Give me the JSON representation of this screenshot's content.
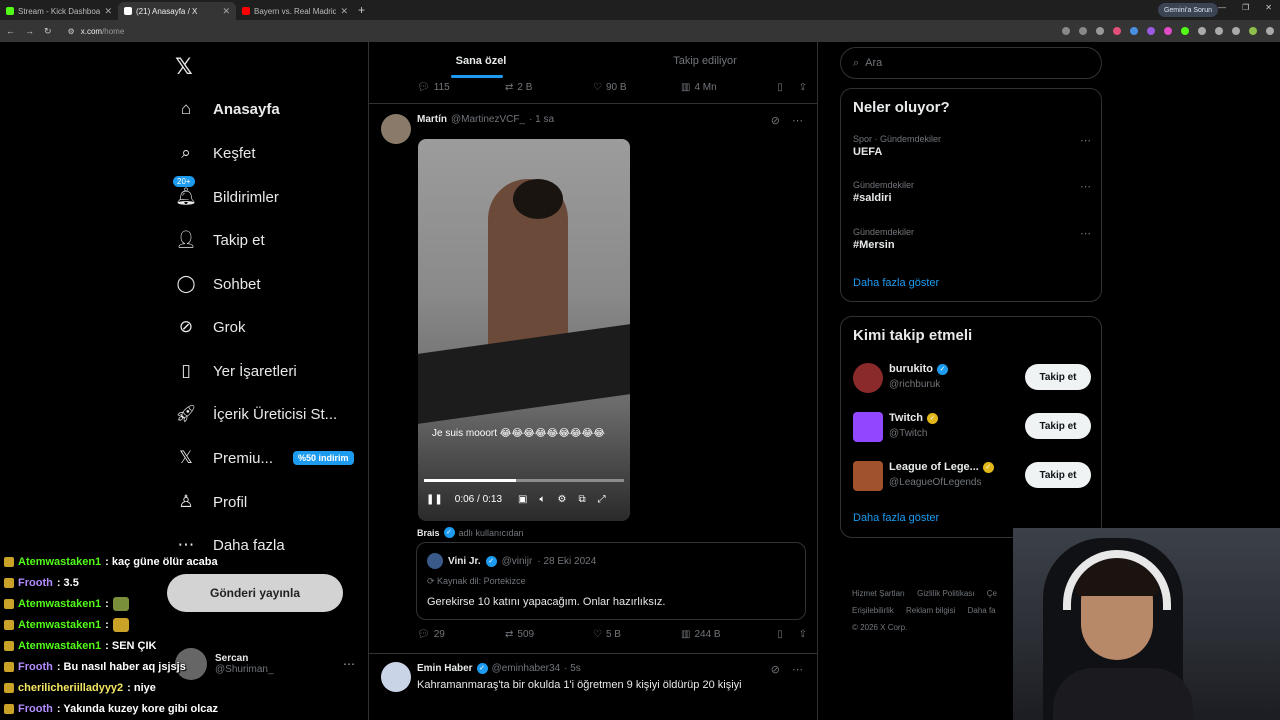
{
  "browser": {
    "tabs": [
      {
        "title": "Stream - Kick Dashboard",
        "color": "#53fc18"
      },
      {
        "title": "(21) Anasayfa / X",
        "color": "#ffffff"
      },
      {
        "title": "Bayern vs. Real Madrid: Extende",
        "color": "#ff0000"
      }
    ],
    "gemini": "Gemini'a Sorun",
    "url_host": "x.com",
    "url_path": "/home"
  },
  "nav": {
    "items": [
      {
        "label": "Anasayfa",
        "icon": "home-icon"
      },
      {
        "label": "Keşfet",
        "icon": "search-icon"
      },
      {
        "label": "Bildirimler",
        "icon": "bell-icon",
        "badge": "20+"
      },
      {
        "label": "Takip et",
        "icon": "person-add-icon"
      },
      {
        "label": "Sohbet",
        "icon": "chat-icon"
      },
      {
        "label": "Grok",
        "icon": "grok-icon"
      },
      {
        "label": "Yer İşaretleri",
        "icon": "bookmark-icon"
      },
      {
        "label": "İçerik Üreticisi St...",
        "icon": "rocket-icon"
      },
      {
        "label": "Premiu...",
        "icon": "x-logo-icon",
        "promo": "%50 indirim"
      },
      {
        "label": "Profil",
        "icon": "person-icon"
      },
      {
        "label": "Daha fazla",
        "icon": "more-circle-icon"
      }
    ],
    "post_button": "Gönderi yayınla",
    "account": {
      "name": "Sercan",
      "handle": "@Shuriman_"
    }
  },
  "chat": [
    {
      "user": "Atemwastaken1",
      "text": ": kaç güne ölür acaba",
      "color": "#53fc18"
    },
    {
      "user": "Frooth",
      "text": ": 3.5",
      "color": "#b38cff"
    },
    {
      "user": "Atemwastaken1",
      "text": ":",
      "color": "#53fc18",
      "emote": true
    },
    {
      "user": "Atemwastaken1",
      "text": ":",
      "color": "#53fc18",
      "emote": true
    },
    {
      "user": "Atemwastaken1",
      "text": ": SEN ÇIK",
      "color": "#53fc18"
    },
    {
      "user": "Frooth",
      "text": ": Bu nasıl haber aq jsjsjs",
      "color": "#b38cff"
    },
    {
      "user": "cherilicheriilladyyy2",
      "text": ": niye",
      "color": "#f5e663"
    },
    {
      "user": "Frooth",
      "text": ": Yakında kuzey kore gibi olcaz",
      "color": "#b38cff"
    }
  ],
  "timeline": {
    "tabs": [
      "Sana özel",
      "Takip ediliyor"
    ],
    "prev_actions": {
      "replies": "115",
      "reposts": "2 B",
      "likes": "90 B",
      "views": "4 Mn"
    },
    "post1": {
      "name": "Martín",
      "handle": "@MartinezVCF_",
      "time": "· 1 sa",
      "video_caption": "Je suis mooort 😂😂😂😂😂😂😂😂😂",
      "video_time": "0:06 / 0:13",
      "video_progress": 0.46,
      "quote_by_name": "Brais",
      "quote_by_text": "adlı kullanıcıdan",
      "quote": {
        "name": "Vini Jr.",
        "handle": "@vinijr",
        "date": "· 28 Eki 2024",
        "source": "Kaynak dil: Portekizce",
        "text": "Gerekirse 10 katını yapacağım. Onlar hazırlıksız."
      },
      "actions": {
        "replies": "29",
        "reposts": "509",
        "likes": "5 B",
        "views": "244 B"
      }
    },
    "post2": {
      "name": "Emin Haber",
      "handle": "@eminhaber34",
      "time": "· 5s",
      "text": "Kahramanmaraş'ta bir okulda 1'i öğretmen 9 kişiyi öldürüp 20 kişiyi"
    }
  },
  "sidebar": {
    "search_placeholder": "Ara",
    "trends_title": "Neler oluyor?",
    "trends": [
      {
        "context": "Spor · Gündemdekiler",
        "title": "UEFA"
      },
      {
        "context": "Gündemdekiler",
        "title": "#saldiri"
      },
      {
        "context": "Gündemdekiler",
        "title": "#Mersin"
      }
    ],
    "show_more": "Daha fazla göster",
    "who_title": "Kimi takip etmeli",
    "who": [
      {
        "name": "burukito",
        "handle": "@richburuk",
        "verified": "blue",
        "color": "#8a2a2a"
      },
      {
        "name": "Twitch",
        "handle": "@Twitch",
        "verified": "gold",
        "color": "#9146ff"
      },
      {
        "name": "League of Lege...",
        "handle": "@LeagueOfLegends",
        "verified": "gold",
        "color": "#a0522d"
      }
    ],
    "follow_label": "Takip et",
    "footer": [
      "Hizmet Şartları",
      "Gizlilik Politikası",
      "Çe",
      "Erişilebilirlik",
      "Reklam bilgisi",
      "Daha fa",
      "© 2026 X Corp."
    ]
  }
}
